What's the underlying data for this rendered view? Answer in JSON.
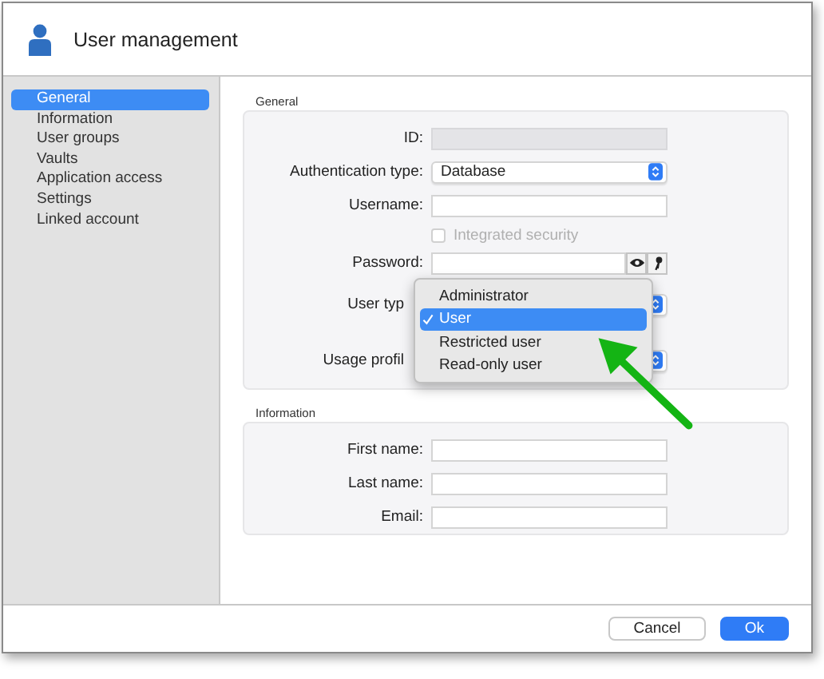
{
  "window": {
    "title": "User management"
  },
  "sidebar": {
    "items": [
      {
        "label": "General",
        "selected": true
      },
      {
        "label": "Information",
        "selected": false
      },
      {
        "label": "User groups",
        "selected": false
      },
      {
        "label": "Vaults",
        "selected": false
      },
      {
        "label": "Application access",
        "selected": false
      },
      {
        "label": "Settings",
        "selected": false
      },
      {
        "label": "Linked account",
        "selected": false
      }
    ]
  },
  "sections": [
    {
      "title": "General",
      "fields": [
        {
          "kind": "text",
          "label": "ID:",
          "disabled": true
        },
        {
          "kind": "select",
          "label": "Authentication type:",
          "value": "Database"
        },
        {
          "kind": "text",
          "label": "Username:",
          "disabled": false
        },
        {
          "kind": "checkbox",
          "label": "Integrated security",
          "checked": false,
          "disabled": true
        },
        {
          "kind": "password",
          "label": "Password:"
        },
        {
          "kind": "covered-select",
          "label": "User typ"
        },
        {
          "kind": "covered-select",
          "label": "Usage profil"
        }
      ]
    },
    {
      "title": "Information",
      "fields": [
        {
          "kind": "text",
          "label": "First name:",
          "disabled": false
        },
        {
          "kind": "text",
          "label": "Last name:",
          "disabled": false
        },
        {
          "kind": "text",
          "label": "Email:",
          "disabled": false
        }
      ]
    }
  ],
  "menu": {
    "items": [
      {
        "label": "Administrator",
        "selected": false
      },
      {
        "label": "User",
        "selected": true
      },
      {
        "label": "Restricted user",
        "selected": false
      },
      {
        "label": "Read-only user",
        "selected": false
      }
    ]
  },
  "buttons": [
    {
      "label": "Cancel",
      "default": false
    },
    {
      "label": "Ok",
      "default": true
    }
  ]
}
